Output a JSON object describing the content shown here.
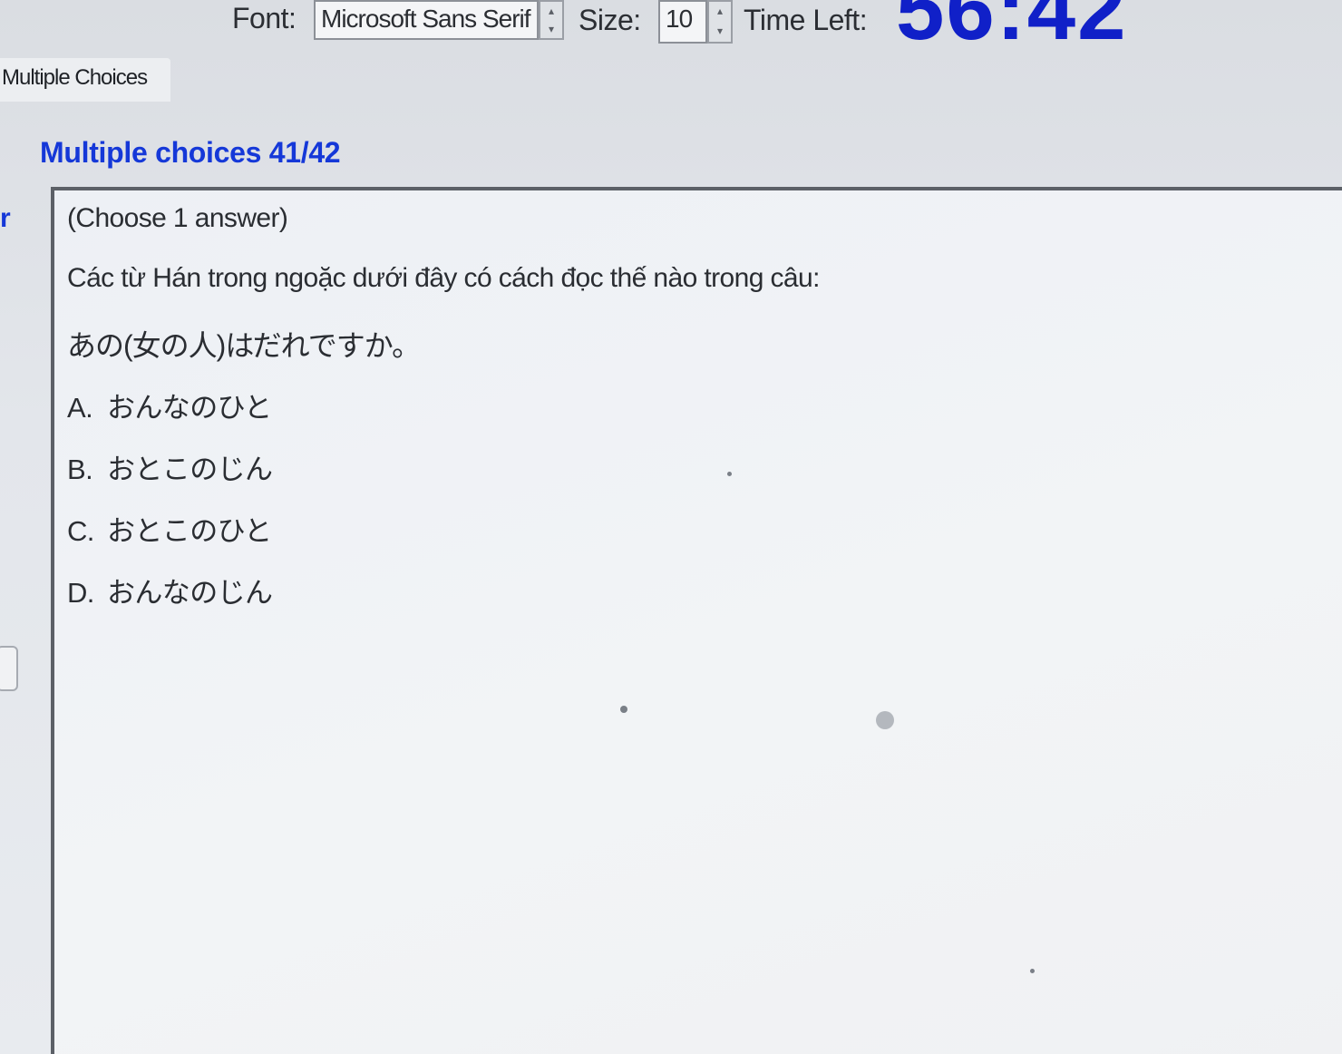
{
  "toolbar": {
    "font_label": "Font:",
    "font_value": "Microsoft Sans Serif",
    "size_label": "Size:",
    "size_value": "10",
    "time_left_label": "Time Left:",
    "time_left_value": "56:42"
  },
  "tab": {
    "label": "Multiple Choices"
  },
  "section": {
    "title": "Multiple choices 41/42",
    "left_fragment": "r"
  },
  "question": {
    "instruction": "(Choose 1 answer)",
    "prompt": "Các từ Hán trong ngoặc dưới đây có cách đọc thế nào trong câu:",
    "sentence": "あの(女の人)はだれですか。",
    "options": [
      {
        "letter": "A.",
        "text": "おんなのひと"
      },
      {
        "letter": "B.",
        "text": "おとこのじん"
      },
      {
        "letter": "C.",
        "text": "おとこのひと"
      },
      {
        "letter": "D.",
        "text": "おんなのじん"
      }
    ]
  },
  "colors": {
    "accent": "#1538d8",
    "timer": "#1020c8",
    "text": "#2a2d32",
    "panel_border": "#5c6067"
  },
  "icons": {
    "spinner_up": "▴",
    "spinner_down": "▾"
  }
}
